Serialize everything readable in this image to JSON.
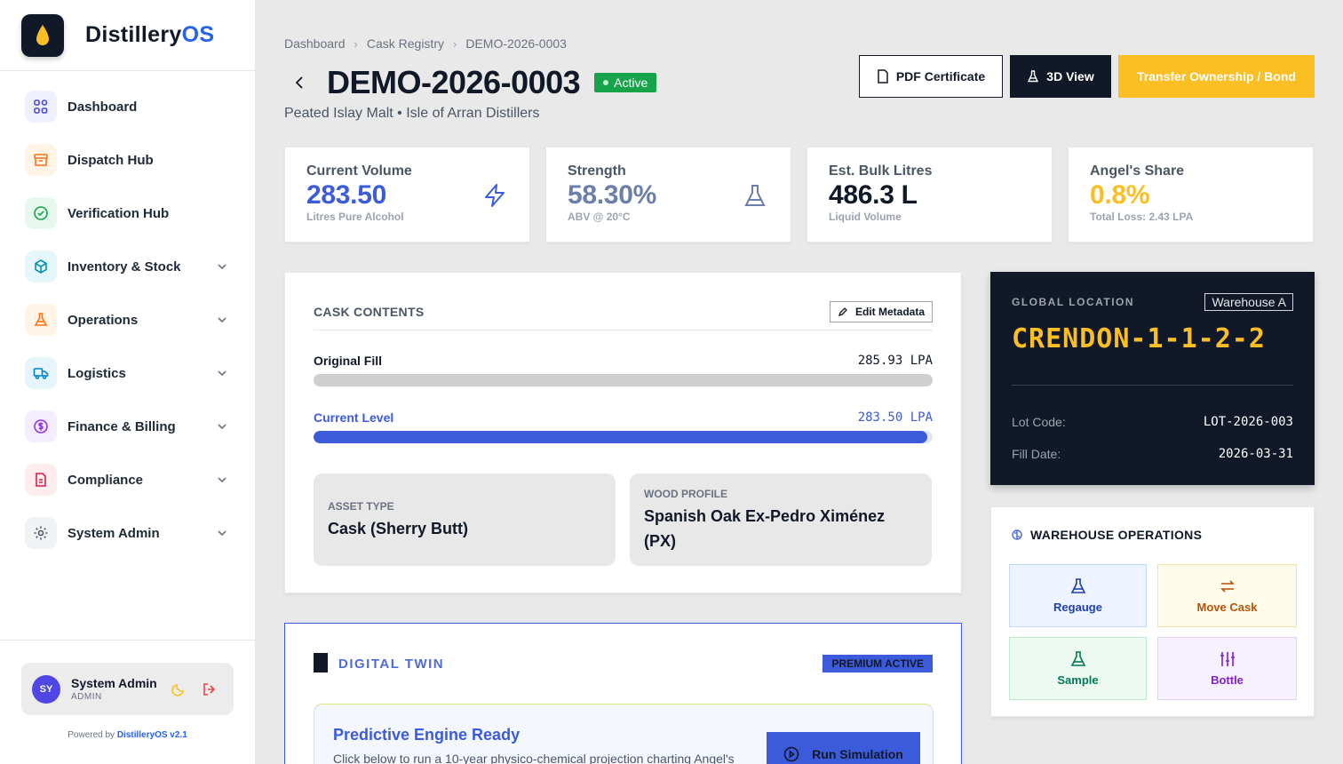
{
  "app": {
    "name_main": "Distillery",
    "name_accent": "OS"
  },
  "sidebar": {
    "items": [
      {
        "label": "Dashboard",
        "icon": "dashboard-icon"
      },
      {
        "label": "Dispatch Hub",
        "icon": "archive-icon"
      },
      {
        "label": "Verification Hub",
        "icon": "check-circle-icon"
      },
      {
        "label": "Inventory & Stock",
        "icon": "box-icon"
      },
      {
        "label": "Operations",
        "icon": "flask-icon"
      },
      {
        "label": "Logistics",
        "icon": "truck-icon"
      },
      {
        "label": "Finance & Billing",
        "icon": "dollar-icon"
      },
      {
        "label": "Compliance",
        "icon": "document-icon"
      },
      {
        "label": "System Admin",
        "icon": "gear-icon"
      }
    ],
    "user": {
      "initials": "SY",
      "name": "System Admin",
      "role": "ADMIN"
    },
    "powered_prefix": "Powered by",
    "powered_brand": "DistilleryOS v2.1"
  },
  "breadcrumb": {
    "items": [
      "Dashboard",
      "Cask Registry",
      "DEMO-2026-0003"
    ]
  },
  "header": {
    "title": "DEMO-2026-0003",
    "status": "Active",
    "subtitle": "Peated Islay Malt • Isle of Arran Distillers",
    "buttons": {
      "pdf": "PDF Certificate",
      "view3d": "3D View",
      "transfer": "Transfer Ownership / Bond"
    }
  },
  "stats": [
    {
      "label": "Current Volume",
      "value": "283.50",
      "sub": "Litres Pure Alcohol",
      "color": "#3b5bdb"
    },
    {
      "label": "Strength",
      "value": "58.30%",
      "sub": "ABV @ 20°C",
      "color": "#6b7fa8"
    },
    {
      "label": "Est. Bulk Litres",
      "value": "486.3 L",
      "sub": "Liquid Volume",
      "color": "#111827"
    },
    {
      "label": "Angel's Share",
      "value": "0.8%",
      "sub": "Total Loss: 2.43 LPA",
      "color": "#fbbf24"
    }
  ],
  "contents": {
    "title": "CASK CONTENTS",
    "edit_label": "Edit Metadata",
    "original_fill": {
      "label": "Original Fill",
      "value": "285.93 LPA",
      "fraction": 1.0
    },
    "current_level": {
      "label": "Current Level",
      "value": "283.50 LPA",
      "fraction": 0.9915
    },
    "asset_type": {
      "label": "ASSET TYPE",
      "value": "Cask (Sherry Butt)"
    },
    "wood_profile": {
      "label": "WOOD PROFILE",
      "value": "Spanish Oak Ex-Pedro Ximénez (PX)"
    }
  },
  "twin": {
    "title": "DIGITAL TWIN",
    "badge": "PREMIUM ACTIVE",
    "engine_title": "Predictive Engine Ready",
    "engine_text": "Click below to run a 10-year physico-chemical projection charting Angel's",
    "run_label": "Run Simulation"
  },
  "location": {
    "label": "GLOBAL LOCATION",
    "warehouse": "Warehouse A",
    "code": "CRENDON-1-1-2-2",
    "lot_label": "Lot Code:",
    "lot_value": "LOT-2026-003",
    "fill_label": "Fill Date:",
    "fill_value": "2026-03-31"
  },
  "ops": {
    "title": "WAREHOUSE OPERATIONS",
    "buttons": [
      {
        "label": "Regauge",
        "icon": "flask-icon"
      },
      {
        "label": "Move Cask",
        "icon": "swap-arrows-icon"
      },
      {
        "label": "Sample",
        "icon": "flask-icon"
      },
      {
        "label": "Bottle",
        "icon": "sliders-icon"
      }
    ]
  },
  "colors": {
    "brand_blue": "#3b5bdb",
    "accent_amber": "#fbbf24",
    "dark": "#111827",
    "active_green": "#16a34a"
  }
}
